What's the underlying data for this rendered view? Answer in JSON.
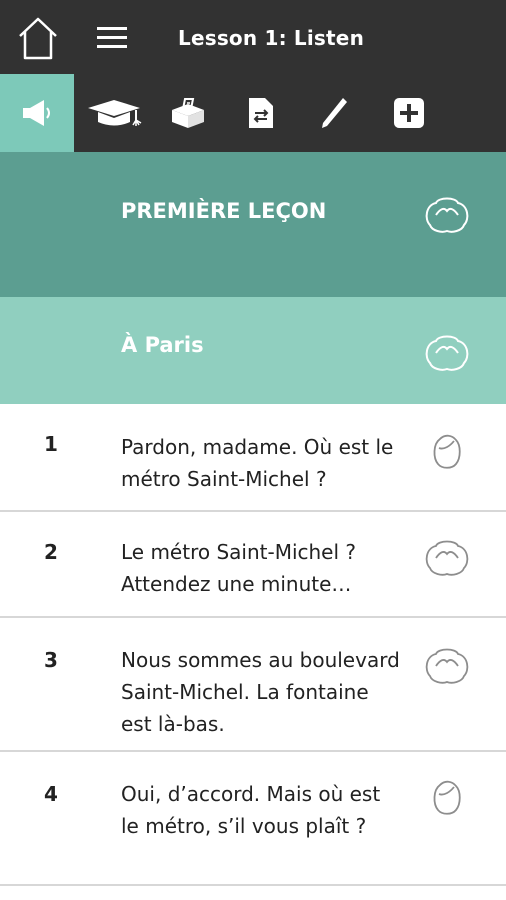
{
  "header": {
    "title": "Lesson 1: Listen",
    "home_icon": "home-icon",
    "menu_icon": "hamburger-menu-icon"
  },
  "toolbar": {
    "tools": [
      {
        "icon": "speaker-icon",
        "active": true
      },
      {
        "icon": "graduation-cap-icon",
        "active": false
      },
      {
        "icon": "ballot-box-icon",
        "active": false
      },
      {
        "icon": "document-swap-icon",
        "active": false
      },
      {
        "icon": "pencil-icon",
        "active": false
      },
      {
        "icon": "plus-square-icon",
        "active": false
      }
    ]
  },
  "sections": {
    "main": {
      "label": "PREMIÈRE LEÇON",
      "icon": "group-avatar-icon"
    },
    "sub": {
      "label": "À Paris",
      "icon": "group-avatar-icon"
    }
  },
  "lines": [
    {
      "number": "1",
      "text": "Pardon, madame. Où est le métro Saint-Michel ?",
      "icon": "female-speaker-icon"
    },
    {
      "number": "2",
      "text": "Le métro Saint-Michel ? Attendez une minute…",
      "icon": "group-avatar-icon"
    },
    {
      "number": "3",
      "text": "Nous sommes au boulevard Saint-Michel. La fontaine est là-bas.",
      "icon": "group-avatar-icon"
    },
    {
      "number": "4",
      "text": "Oui, d’accord. Mais où est le métro, s’il vous plaît ?",
      "icon": "female-speaker-icon"
    }
  ],
  "colors": {
    "bar": "#323232",
    "active_tool": "#7dc9b9",
    "section_main": "#5c9e91",
    "section_sub": "#90cfbf",
    "divider": "#d7d7d7"
  }
}
